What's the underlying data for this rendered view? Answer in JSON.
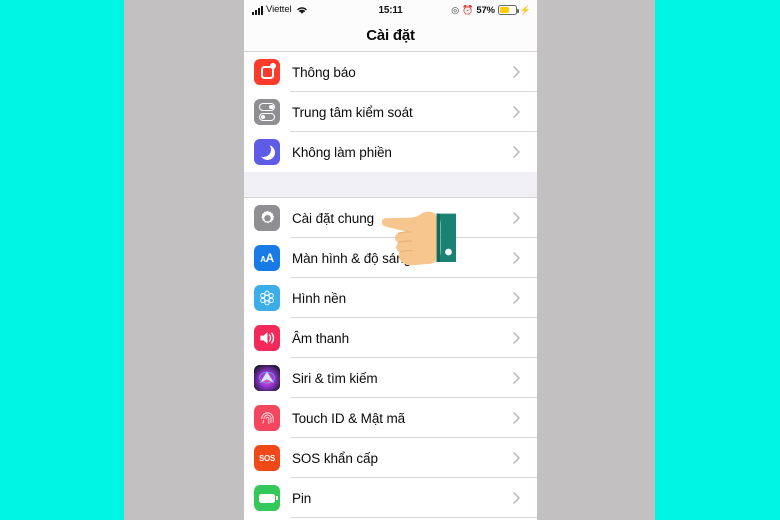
{
  "screen": {
    "background_color": "#00F5E4",
    "backdrop_color": "#C3C0C1",
    "phone_background": "#FFFFFF"
  },
  "status_bar": {
    "carrier": "Viettel",
    "signal_icon": "cellular-signal-icon",
    "wifi_icon": "wifi-icon",
    "time": "15:11",
    "rotation_lock_icon": "rotation-lock-icon",
    "alarm_icon": "alarm-clock-icon",
    "battery_percent": "57%",
    "battery_level": 57,
    "battery_color": "#FFCC00",
    "charging_icon": "lightning-bolt-icon"
  },
  "nav_bar": {
    "title": "Cài đặt"
  },
  "groups": [
    {
      "rows": [
        {
          "label": "Thông báo",
          "icon": "notifications-icon",
          "icon_color": "#FC3B2D"
        },
        {
          "label": "Trung tâm kiểm soát",
          "icon": "control-center-icon",
          "icon_color": "#8E8E93"
        },
        {
          "label": "Không làm phiền",
          "icon": "do-not-disturb-moon-icon",
          "icon_color": "#5E5CE6"
        }
      ]
    },
    {
      "rows": [
        {
          "label": "Cài đặt chung",
          "icon": "general-gear-icon",
          "icon_color": "#8E8E93"
        },
        {
          "label": "Màn hình & độ sáng",
          "icon": "display-brightness-icon",
          "icon_color": "#177AE5"
        },
        {
          "label": "Hình nền",
          "icon": "wallpaper-icon",
          "icon_color": "#3BAEE8"
        },
        {
          "label": "Âm thanh",
          "icon": "sound-speaker-icon",
          "icon_color": "#F2295B"
        },
        {
          "label": "Siri & tìm kiếm",
          "icon": "siri-search-icon",
          "icon_color": "#1B1A2B"
        },
        {
          "label": "Touch ID & Mật mã",
          "icon": "touch-id-fingerprint-icon",
          "icon_color": "#F4465E"
        },
        {
          "label": "SOS khẩn cấp",
          "icon": "emergency-sos-icon",
          "icon_color": "#F1481A",
          "icon_text": "SOS"
        },
        {
          "label": "Pin",
          "icon": "battery-icon",
          "icon_color": "#34C759"
        }
      ]
    }
  ],
  "cursor": {
    "type": "pointing-hand-cursor",
    "skin_color": "#F7C68F",
    "sleeve_color": "#1B8273",
    "points_at": "Cài đặt chung"
  },
  "chevron_icon": "chevron-right-icon"
}
